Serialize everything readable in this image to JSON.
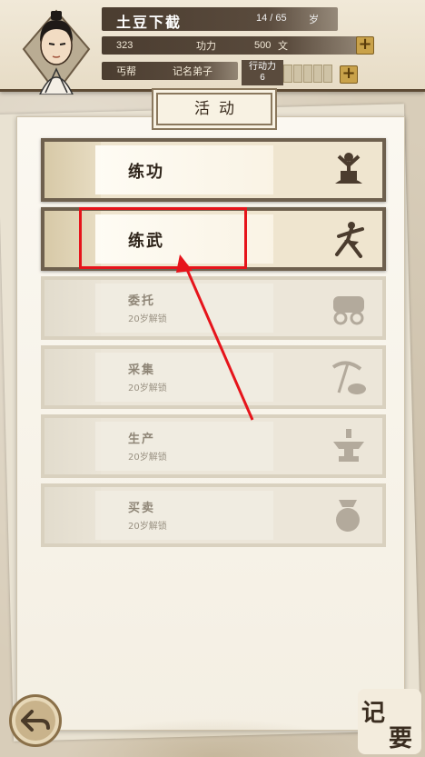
{
  "header": {
    "name": "土豆下截",
    "age": "14 / 65",
    "age_unit": "岁",
    "stat_value": "323",
    "stat_label": "功力",
    "money_value": "500",
    "money_unit": "文",
    "sect": "丐帮",
    "rank": "记名弟子",
    "action_label": "行动力",
    "action_value": "6"
  },
  "panel": {
    "title": "活动"
  },
  "activities": [
    {
      "label": "练功",
      "icon": "meditation-icon",
      "locked": false
    },
    {
      "label": "练武",
      "icon": "martial-arts-icon",
      "locked": false
    },
    {
      "label": "委托",
      "sub": "20岁解锁",
      "icon": "cart-icon",
      "locked": true
    },
    {
      "label": "采集",
      "sub": "20岁解锁",
      "icon": "pickaxe-icon",
      "locked": true
    },
    {
      "label": "生产",
      "sub": "20岁解锁",
      "icon": "anvil-icon",
      "locked": true
    },
    {
      "label": "买卖",
      "sub": "20岁解锁",
      "icon": "money-bag-icon",
      "locked": true
    }
  ],
  "footer": {
    "notes_label_1": "记",
    "notes_label_2": "要"
  },
  "colors": {
    "highlight": "#e6141b",
    "card_border": "#6e604e"
  }
}
